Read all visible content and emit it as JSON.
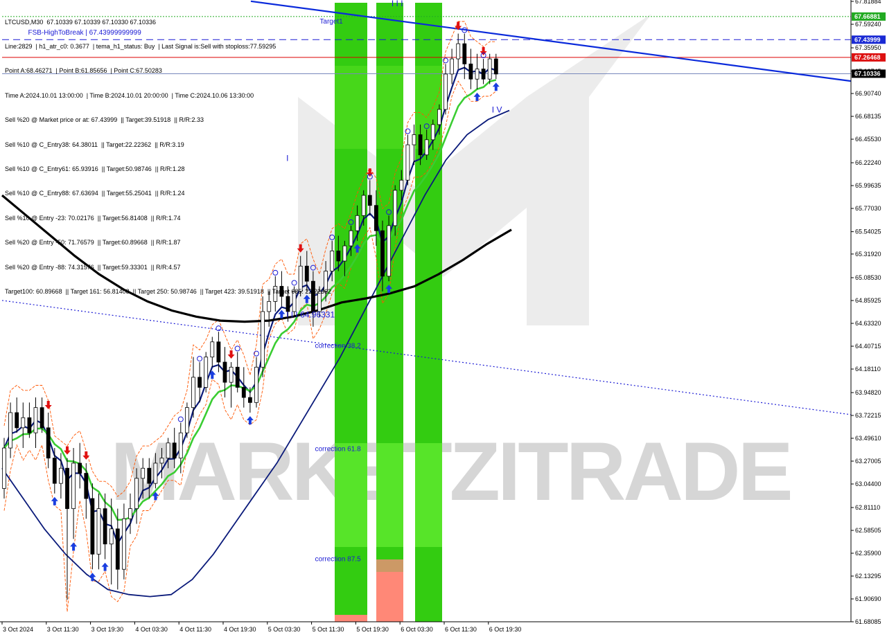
{
  "window": {
    "symbol_line": "LTCUSD,M30  67.10339 67.10339 67.10330 67.10336"
  },
  "info_lines": [
    "Line:2829  | h1_atr_c0: 0.3677  | tema_h1_status: Buy  | Last Signal is:Sell with stoploss:77.59295",
    "Point A:68.46271  | Point B:61.85656  | Point C:67.50283",
    "Time A:2024.10.01 13:00:00  | Time B:2024.10.01 20:00:00  | Time C:2024.10.06 13:30:00",
    "Sell %20 @ Market price or at: 67.43999  || Target:39.51918  || R/R:2.33",
    "Sell %10 @ C_Entry38: 64.38011  || Target:22.22362  || R/R:3.19",
    "Sell %10 @ C_Entry61: 65.93916  || Target:50.98746  || R/R:1.28",
    "Sell %10 @ C_Entry88: 67.63694  || Target:55.25041  || R/R:1.24",
    "Sell %10 @ Entry -23: 70.02176  || Target:56.81408  || R/R:1.74",
    "Sell %20 @ Entry -50: 71.76579  || Target:60.89668  || R/R:1.87",
    "Sell %20 @ Entry -88: 74.31576  || Target:59.33301  || R/R:4.57",
    "Target100: 60.89668  || Target 161: 56.81408  || Target 250: 50.98746  || Target 423: 39.51918  || Target 685: 22.22362"
  ],
  "chart_data": {
    "type": "candlestick",
    "symbol": "LTCUSD",
    "timeframe": "M30",
    "watermark": "MARKETZITRADE",
    "colors": {
      "background": "#ffffff",
      "candle": "#000000",
      "green_zone": "#33cc11",
      "green_zone_light": "#66ee33",
      "salmon_zone": "#ff8877",
      "ma_black": "#000000",
      "ma_navy": "#0a1a7a",
      "ma_green": "#3acd32",
      "trendline": "#0a2adb",
      "red_line": "#dd0000",
      "fib_line": "#1a1ad4",
      "orange_band": "#ff5500",
      "up_arrow": "#1a3ee0",
      "down_arrow": "#e01010"
    },
    "y_range": [
      61.6808,
      67.81884
    ],
    "y_ticks": [
      "67.81884",
      "67.59240",
      "67.35950",
      "67.12745",
      "66.90740",
      "66.68135",
      "66.45530",
      "66.22240",
      "65.99635",
      "65.77030",
      "65.54025",
      "65.31920",
      "65.08530",
      "64.85925",
      "64.63320",
      "64.40715",
      "64.18110",
      "63.94820",
      "63.72215",
      "63.49610",
      "63.27005",
      "63.04400",
      "62.81110",
      "62.58505",
      "62.35900",
      "62.13295",
      "61.90690",
      "61.68085"
    ],
    "x_ticks": [
      "3 Oct 2024",
      "3 Oct 11:30",
      "3 Oct 19:30",
      "4 Oct 03:30",
      "4 Oct 11:30",
      "4 Oct 19:30",
      "5 Oct 03:30",
      "5 Oct 11:30",
      "5 Oct 19:30",
      "6 Oct 03:30",
      "6 Oct 11:30",
      "6 Oct 19:30"
    ],
    "price_tags": [
      {
        "label": "67.66881",
        "value": 67.66881,
        "color": "#22aa22"
      },
      {
        "label": "67.43999",
        "value": 67.43999,
        "color": "#1a2ad4"
      },
      {
        "label": "67.26468",
        "value": 67.26468,
        "color": "#dd1111"
      },
      {
        "label": "67.10336",
        "value": 67.10336,
        "color": "#000000"
      }
    ],
    "annotations": [
      {
        "text": "I I I",
        "x": 81,
        "y": 67.77
      },
      {
        "text": "I I I 64.96331",
        "x": 59,
        "y": 64.69
      },
      {
        "text": "I",
        "x": 59,
        "y": 66.24
      },
      {
        "text": "I V",
        "x": 102,
        "y": 66.72
      },
      {
        "text": "Target1",
        "x": 66,
        "y": 67.6
      },
      {
        "text": "FSB-HighToBreak | 67.43999999999",
        "x": 5,
        "y": 67.49
      },
      {
        "text": "correction 38.2",
        "x": 65,
        "y": 64.39
      },
      {
        "text": "correction 61.8",
        "x": 65,
        "y": 63.37
      },
      {
        "text": "correction 87.5",
        "x": 65,
        "y": 62.28
      }
    ],
    "candles": [
      [
        63.0,
        63.5,
        62.9,
        63.4
      ],
      [
        63.4,
        63.85,
        63.3,
        63.75
      ],
      [
        63.75,
        63.9,
        63.55,
        63.6
      ],
      [
        63.6,
        63.85,
        63.4,
        63.7
      ],
      [
        63.7,
        63.85,
        63.5,
        63.55
      ],
      [
        63.55,
        63.9,
        63.4,
        63.8
      ],
      [
        63.8,
        63.9,
        63.55,
        63.6
      ],
      [
        63.6,
        63.75,
        63.2,
        63.3
      ],
      [
        63.3,
        63.4,
        62.95,
        63.05
      ],
      [
        63.05,
        63.35,
        62.9,
        63.2
      ],
      [
        63.2,
        63.3,
        61.9,
        62.8
      ],
      [
        62.8,
        63.4,
        62.5,
        63.25
      ],
      [
        63.25,
        63.45,
        63.0,
        63.15
      ],
      [
        63.15,
        63.25,
        62.7,
        62.9
      ],
      [
        62.9,
        63.05,
        62.2,
        62.35
      ],
      [
        62.35,
        62.95,
        62.2,
        62.8
      ],
      [
        62.8,
        62.95,
        62.3,
        62.45
      ],
      [
        62.45,
        62.9,
        62.05,
        62.6
      ],
      [
        62.6,
        62.8,
        62.0,
        62.2
      ],
      [
        62.2,
        62.85,
        62.1,
        62.7
      ],
      [
        62.7,
        62.95,
        62.55,
        62.8
      ],
      [
        62.8,
        63.2,
        62.65,
        63.1
      ],
      [
        63.1,
        63.3,
        62.9,
        63.2
      ],
      [
        63.2,
        63.3,
        62.9,
        63.05
      ],
      [
        63.05,
        63.35,
        63.0,
        63.25
      ],
      [
        63.25,
        63.4,
        63.1,
        63.3
      ],
      [
        63.3,
        63.5,
        63.2,
        63.45
      ],
      [
        63.45,
        63.6,
        63.2,
        63.3
      ],
      [
        63.3,
        63.65,
        63.15,
        63.55
      ],
      [
        63.55,
        63.85,
        63.5,
        63.8
      ],
      [
        63.8,
        64.3,
        63.7,
        64.1
      ],
      [
        64.1,
        64.25,
        63.85,
        64.0
      ],
      [
        64.0,
        64.35,
        63.95,
        64.3
      ],
      [
        64.3,
        64.5,
        64.2,
        64.45
      ],
      [
        64.45,
        64.55,
        64.15,
        64.25
      ],
      [
        64.25,
        64.4,
        63.9,
        64.05
      ],
      [
        64.05,
        64.25,
        63.8,
        64.2
      ],
      [
        64.2,
        64.35,
        63.95,
        64.0
      ],
      [
        64.0,
        64.2,
        63.8,
        63.9
      ],
      [
        63.9,
        64.0,
        63.75,
        63.85
      ],
      [
        63.85,
        64.3,
        63.8,
        64.2
      ],
      [
        64.2,
        64.9,
        64.1,
        64.75
      ],
      [
        64.75,
        64.95,
        64.6,
        64.85
      ],
      [
        64.85,
        65.1,
        64.75,
        65.0
      ],
      [
        65.0,
        65.15,
        64.8,
        64.9
      ],
      [
        64.9,
        65.0,
        64.65,
        64.75
      ],
      [
        64.75,
        65.0,
        64.7,
        64.95
      ],
      [
        64.95,
        65.3,
        64.9,
        65.2
      ],
      [
        65.2,
        65.35,
        64.95,
        65.05
      ],
      [
        65.05,
        65.15,
        64.6,
        64.75
      ],
      [
        64.75,
        65.0,
        64.7,
        64.95
      ],
      [
        64.95,
        65.25,
        64.85,
        65.15
      ],
      [
        65.15,
        65.45,
        65.05,
        65.35
      ],
      [
        65.35,
        65.5,
        65.15,
        65.25
      ],
      [
        65.25,
        65.45,
        65.1,
        65.4
      ],
      [
        65.4,
        65.6,
        65.3,
        65.55
      ],
      [
        65.55,
        65.8,
        65.45,
        65.7
      ],
      [
        65.7,
        65.95,
        65.6,
        65.9
      ],
      [
        65.9,
        66.05,
        65.7,
        65.8
      ],
      [
        65.8,
        65.95,
        65.4,
        65.55
      ],
      [
        65.55,
        65.65,
        64.95,
        65.1
      ],
      [
        65.1,
        65.7,
        65.05,
        65.6
      ],
      [
        65.6,
        66.0,
        65.5,
        65.95
      ],
      [
        65.95,
        66.15,
        65.85,
        66.05
      ],
      [
        66.05,
        66.5,
        66.0,
        66.4
      ],
      [
        66.4,
        66.6,
        66.2,
        66.5
      ],
      [
        66.5,
        66.6,
        66.2,
        66.3
      ],
      [
        66.3,
        66.55,
        66.25,
        66.45
      ],
      [
        66.45,
        66.65,
        66.35,
        66.6
      ],
      [
        66.6,
        66.8,
        66.5,
        66.75
      ],
      [
        66.75,
        67.2,
        66.7,
        67.1
      ],
      [
        67.1,
        67.35,
        67.0,
        67.25
      ],
      [
        67.25,
        67.5,
        67.15,
        67.4
      ],
      [
        67.4,
        67.5,
        67.05,
        67.2
      ],
      [
        67.2,
        67.35,
        66.95,
        67.05
      ],
      [
        67.05,
        67.3,
        66.95,
        67.15
      ],
      [
        67.15,
        67.25,
        67.0,
        67.05
      ],
      [
        67.05,
        67.3,
        67.0,
        67.25
      ],
      [
        67.25,
        67.3,
        67.05,
        67.1
      ]
    ]
  }
}
